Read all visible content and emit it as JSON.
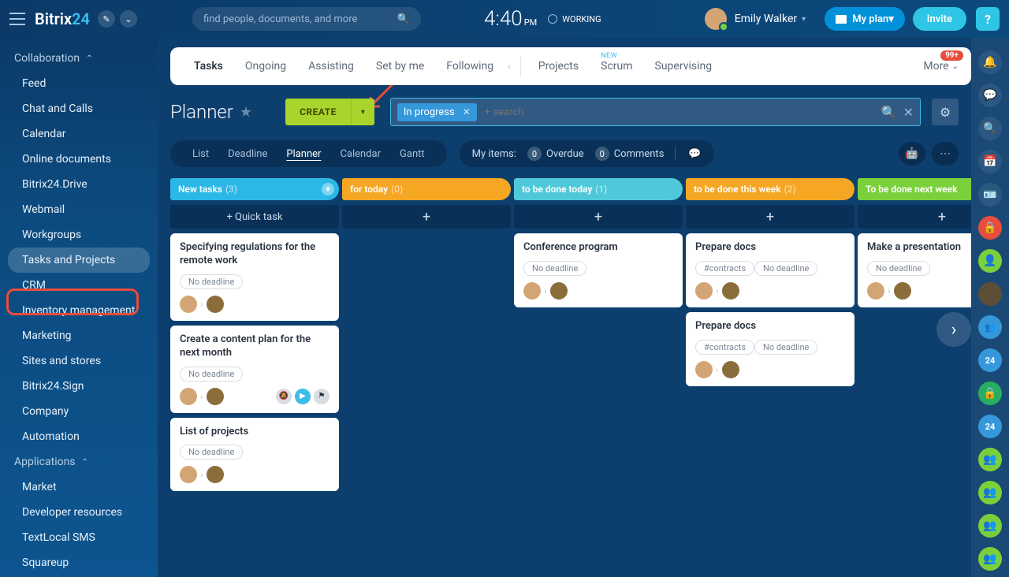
{
  "header": {
    "brand1": "Bitrix",
    "brand2": "24",
    "search_placeholder": "find people, documents, and more",
    "clock_time": "4:40",
    "clock_pm": "PM",
    "working": "WORKING",
    "user_name": "Emily Walker",
    "plan_btn": "My plan",
    "invite_btn": "Invite",
    "help": "?"
  },
  "sidebar": {
    "group1": "Collaboration",
    "items1": [
      "Feed",
      "Chat and Calls",
      "Calendar",
      "Online documents",
      "Bitrix24.Drive",
      "Webmail",
      "Workgroups",
      "Tasks and Projects",
      "CRM",
      "Inventory management",
      "Marketing",
      "Sites and stores",
      "Bitrix24.Sign",
      "Company",
      "Automation"
    ],
    "group2": "Applications",
    "items2": [
      "Market",
      "Developer resources",
      "TextLocal SMS",
      "Squareup"
    ]
  },
  "tabs": {
    "list": [
      "Tasks",
      "Ongoing",
      "Assisting",
      "Set by me",
      "Following"
    ],
    "list2": [
      "Projects",
      "Scrum",
      "Supervising"
    ],
    "new_label": "NEW",
    "more": "More",
    "badge": "99+"
  },
  "planner": {
    "title": "Planner",
    "create": "CREATE",
    "chip": "In progress",
    "search_placeholder": "+ search"
  },
  "views": {
    "list": [
      "List",
      "Deadline",
      "Planner",
      "Calendar",
      "Gantt"
    ],
    "my_label": "My items:",
    "overdue_cnt": "0",
    "overdue": "Overdue",
    "comments_cnt": "0",
    "comments": "Comments"
  },
  "columns": [
    {
      "title": "New tasks",
      "count": "(3)",
      "cls": "c-blue",
      "quick": "+ Quick task",
      "cards": [
        {
          "title": "Specifying regulations for the remote work",
          "tag": "No deadline"
        },
        {
          "title": "Create a content plan for the next month",
          "tag": "No deadline",
          "actions": true
        },
        {
          "title": "List of projects",
          "tag": "No deadline"
        }
      ]
    },
    {
      "title": "for today",
      "count": "(0)",
      "cls": "c-orange",
      "cards": []
    },
    {
      "title": "to be done today",
      "count": "(1)",
      "cls": "c-teal",
      "cards": [
        {
          "title": "Conference program",
          "tag": "No deadline"
        }
      ]
    },
    {
      "title": "to be done this week",
      "count": "(2)",
      "cls": "c-orange2",
      "cards": [
        {
          "title": "Prepare docs",
          "hash": "#contracts",
          "tag": "No deadline"
        },
        {
          "title": "Prepare docs",
          "hash": "#contracts",
          "tag": "No deadline"
        }
      ]
    },
    {
      "title": "To be done next week",
      "count": "",
      "cls": "c-green",
      "cards": [
        {
          "title": "Make a presentation",
          "tag": "No deadline"
        }
      ]
    }
  ]
}
